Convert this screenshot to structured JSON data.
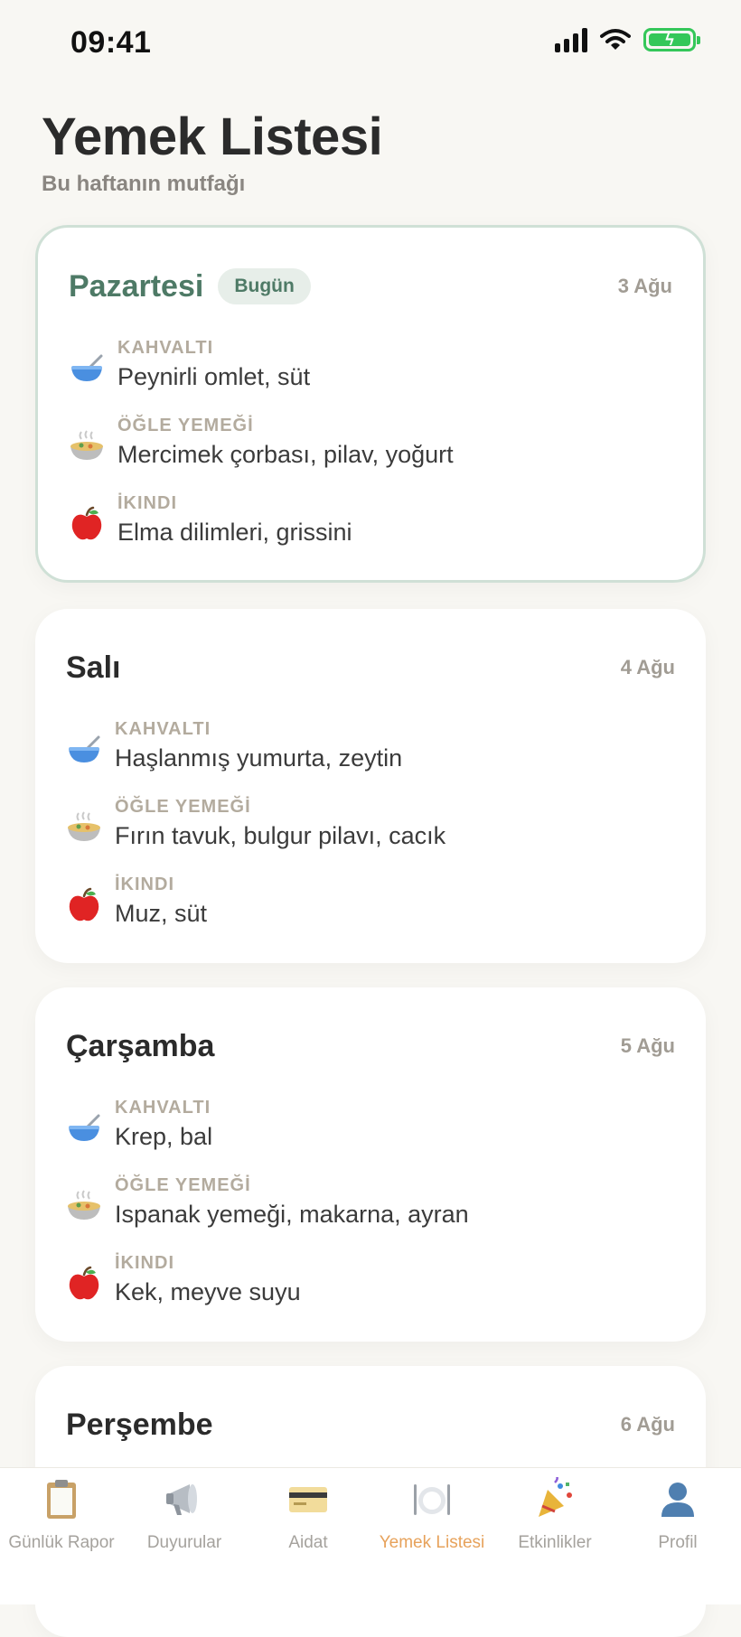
{
  "status_bar": {
    "time": "09:41"
  },
  "header": {
    "title": "Yemek Listesi",
    "subtitle": "Bu haftanın mutfağı"
  },
  "days": [
    {
      "name": "Pazartesi",
      "badge": "Bugün",
      "date": "3 Ağu",
      "meals": [
        {
          "label": "KAHVALTI",
          "desc": "Peynirli omlet, süt",
          "icon": "bowl-icon"
        },
        {
          "label": "ÖĞLE YEMEĞİ",
          "desc": "Mercimek çorbası, pilav, yoğurt",
          "icon": "stew-icon"
        },
        {
          "label": "İKINDI",
          "desc": "Elma dilimleri, grissini",
          "icon": "apple-icon"
        }
      ]
    },
    {
      "name": "Salı",
      "date": "4 Ağu",
      "meals": [
        {
          "label": "KAHVALTI",
          "desc": "Haşlanmış yumurta, zeytin",
          "icon": "bowl-icon"
        },
        {
          "label": "ÖĞLE YEMEĞİ",
          "desc": "Fırın tavuk, bulgur pilavı, cacık",
          "icon": "stew-icon"
        },
        {
          "label": "İKINDI",
          "desc": "Muz, süt",
          "icon": "apple-icon"
        }
      ]
    },
    {
      "name": "Çarşamba",
      "date": "5 Ağu",
      "meals": [
        {
          "label": "KAHVALTI",
          "desc": "Krep, bal",
          "icon": "bowl-icon"
        },
        {
          "label": "ÖĞLE YEMEĞİ",
          "desc": "Ispanak yemeği, makarna, ayran",
          "icon": "stew-icon"
        },
        {
          "label": "İKINDI",
          "desc": "Kek, meyve suyu",
          "icon": "apple-icon"
        }
      ]
    },
    {
      "name": "Perşembe",
      "date": "6 Ağu"
    }
  ],
  "tabs": [
    {
      "label": "Günlük Rapor",
      "icon": "clipboard-icon"
    },
    {
      "label": "Duyurular",
      "icon": "megaphone-icon"
    },
    {
      "label": "Aidat",
      "icon": "credit-card-icon"
    },
    {
      "label": "Yemek Listesi",
      "icon": "plate-icon",
      "active": true
    },
    {
      "label": "Etkinlikler",
      "icon": "party-popper-icon"
    },
    {
      "label": "Profil",
      "icon": "person-icon"
    }
  ],
  "colors": {
    "background": "#F8F7F3",
    "accent_green": "#4E7A66",
    "active_tab": "#E7A25B",
    "muted": "#A19C94"
  }
}
